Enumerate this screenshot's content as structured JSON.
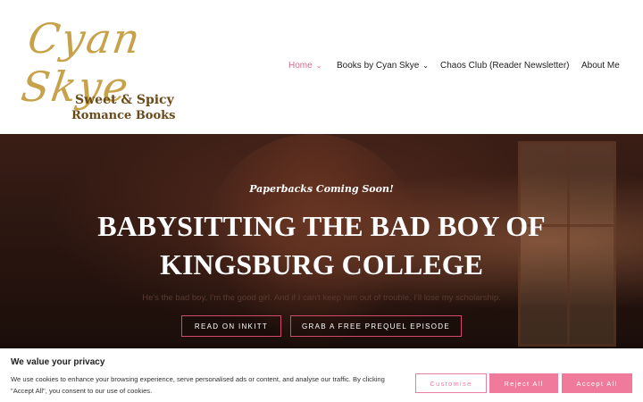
{
  "brand": {
    "script_name": "Cyan Skye",
    "subtitle_line1": "Sweet & Spicy",
    "subtitle_line2": "Romance Books"
  },
  "nav": {
    "items": [
      {
        "label": "Home",
        "has_dropdown": true,
        "active": true
      },
      {
        "label": "Books by Cyan Skye",
        "has_dropdown": true,
        "active": false
      },
      {
        "label": "Chaos Club (Reader Newsletter)",
        "has_dropdown": false,
        "active": false
      },
      {
        "label": "About Me",
        "has_dropdown": false,
        "active": false
      }
    ]
  },
  "hero": {
    "tagline": "Paperbacks Coming Soon!",
    "title_line1": "BABYSITTING THE BAD BOY OF",
    "title_line2": "KINGSBURG COLLEGE",
    "blurb": "He's the bad boy, I'm the good girl. And if I can't keep him out of trouble, I'll lose my scholarship.",
    "buttons": {
      "read": "READ ON INKITT",
      "prequel": "GRAB A FREE PREQUEL EPISODE"
    }
  },
  "cookie": {
    "title": "We value your privacy",
    "text": "We use cookies to enhance your browsing experience, serve personalised ads or content, and analyse our traffic. By clicking \"Accept All\", you consent to our use of cookies.",
    "customise": "Customise",
    "reject": "Reject All",
    "accept": "Accept All"
  },
  "colors": {
    "accent": "#f07a9b",
    "nav_active": "#d16a8f",
    "logo_gold": "#c8a24a"
  },
  "icons": {
    "dropdown": "chevron-down-icon"
  }
}
